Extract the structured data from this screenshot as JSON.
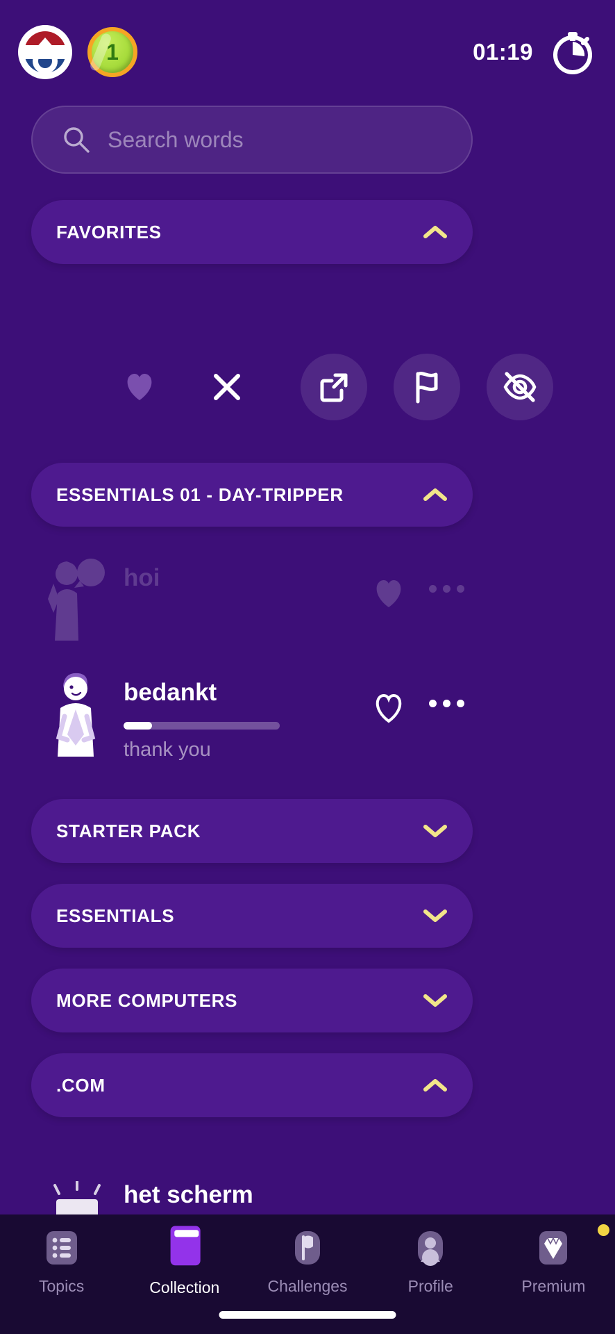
{
  "theme": {
    "bg": "#3d0f78",
    "pill_bg": "#4e1a8f",
    "accent_yellow": "#f2d544",
    "nav_bg": "#190a33",
    "active_purple": "#9333ea"
  },
  "topbar": {
    "flag_icon": "netherlands-flag-icon",
    "coin_icon": "coin-icon",
    "coin_count": "1",
    "timer_value": "01:19",
    "timer_icon": "stopwatch-icon"
  },
  "search": {
    "placeholder": "Search words",
    "value": "",
    "icon": "search-icon"
  },
  "favorites": {
    "label": "FAVORITES",
    "chevron": "chevron-up-icon",
    "expanded": true
  },
  "actions": [
    {
      "name": "favorite-filled-icon",
      "label": "heart"
    },
    {
      "name": "close-icon",
      "label": "x"
    },
    {
      "name": "share-external-icon",
      "label": "share"
    },
    {
      "name": "flag-icon",
      "label": "flag"
    },
    {
      "name": "eye-off-icon",
      "label": "hide"
    }
  ],
  "essentials_day_tripper": {
    "label": "ESSENTIALS 01 - DAY-TRIPPER",
    "chevron": "chevron-up-icon",
    "expanded": true
  },
  "words": [
    {
      "term": "hoi",
      "translation": "",
      "progress": 0,
      "favorite": true,
      "dimmed": true,
      "heart_icon": "heart-filled-icon",
      "menu_icon": "more-options-icon",
      "avatar": "waving-person-illustration"
    },
    {
      "term": "bedankt",
      "translation": "thank you",
      "progress": 18,
      "favorite": false,
      "dimmed": false,
      "heart_icon": "heart-outline-icon",
      "menu_icon": "more-options-icon",
      "avatar": "thankful-person-illustration"
    }
  ],
  "sections": [
    {
      "label": "STARTER PACK",
      "chevron": "chevron-down-icon",
      "expanded": false
    },
    {
      "label": "ESSENTIALS",
      "chevron": "chevron-down-icon",
      "expanded": false
    },
    {
      "label": "MORE COMPUTERS",
      "chevron": "chevron-down-icon",
      "expanded": false
    },
    {
      "label": ".COM",
      "chevron": "chevron-up-icon",
      "expanded": true
    }
  ],
  "peek_word": {
    "term": "het scherm",
    "avatar": "screen-illustration"
  },
  "bottom_nav": [
    {
      "label": "Topics",
      "icon": "list-icon",
      "active": false,
      "badge": false
    },
    {
      "label": "Collection",
      "icon": "book-icon",
      "active": true,
      "badge": false
    },
    {
      "label": "Challenges",
      "icon": "flag-icon",
      "active": false,
      "badge": false
    },
    {
      "label": "Profile",
      "icon": "person-icon",
      "active": false,
      "badge": false
    },
    {
      "label": "Premium",
      "icon": "diamond-icon",
      "active": false,
      "badge": true
    }
  ]
}
